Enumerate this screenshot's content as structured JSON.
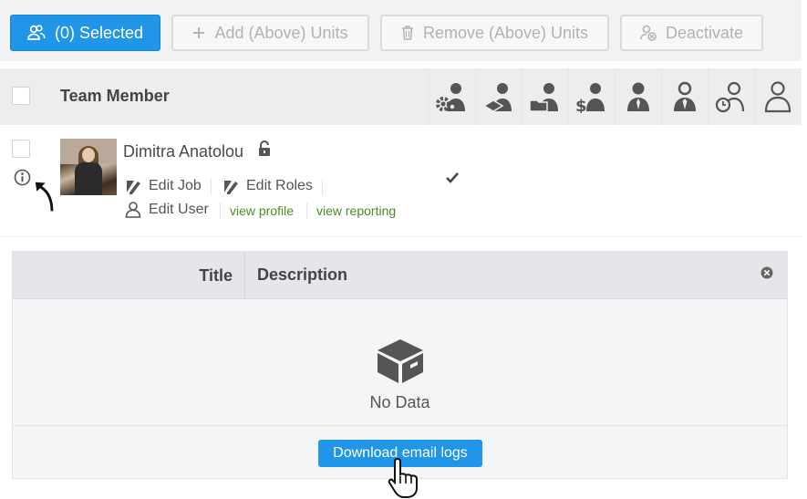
{
  "toolbar": {
    "selected_label": "(0) Selected",
    "add_label": "Add (Above) Units",
    "remove_label": "Remove (Above) Units",
    "deactivate_label": "Deactivate"
  },
  "table_header": {
    "team_member_label": "Team Member",
    "role_icons": [
      "team-settings-icon",
      "team-education-icon",
      "team-folder-icon",
      "team-billing-icon",
      "team-manager-icon",
      "team-executive-icon",
      "team-timer-icon",
      "team-user-icon"
    ]
  },
  "member": {
    "name": "Dimitra Anatolou",
    "edit_job": "Edit Job",
    "edit_roles": "Edit Roles",
    "edit_user": "Edit User",
    "view_profile": "view profile",
    "view_reporting": "view reporting",
    "checkmark": "✔"
  },
  "panel": {
    "col_title": "Title",
    "col_description": "Description",
    "empty_text": "No Data",
    "download_label": "Download email logs"
  },
  "colors": {
    "accent": "#2196e8",
    "link": "#4a8b2a"
  }
}
